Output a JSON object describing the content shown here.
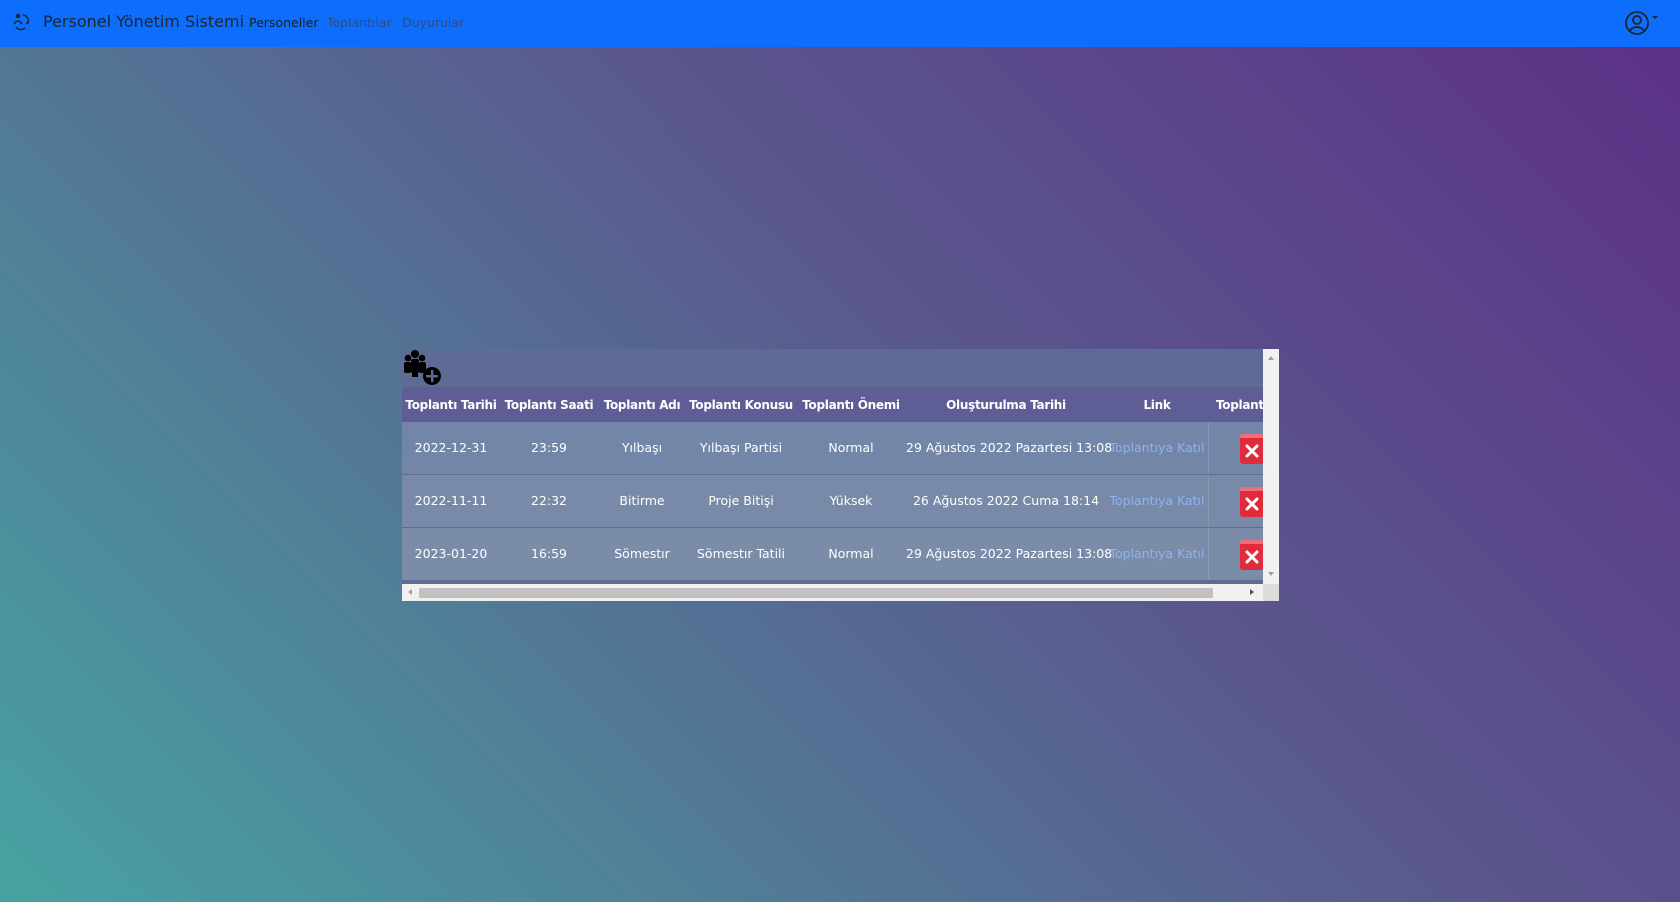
{
  "app": {
    "brand": "Personel Yönetim Sistemi",
    "brand_icon": "refresh-people-icon",
    "accent_color": "#0d6efd"
  },
  "nav": {
    "items": [
      {
        "label": "Personeller",
        "state": "active"
      },
      {
        "label": "Toplantılar",
        "state": "muted"
      },
      {
        "label": "Duyurular",
        "state": "muted"
      }
    ],
    "user_icon": "user-circle-icon"
  },
  "meetings": {
    "add_icon": "add-group-icon",
    "columns": [
      "Toplantı Tarihi",
      "Toplantı Saati",
      "Toplantı Adı",
      "Toplantı Konusu",
      "Toplantı Önemi",
      "Oluşturulma Tarihi",
      "Link",
      "Toplant"
    ],
    "rows": [
      {
        "date": "2022-12-31",
        "time": "23:59",
        "name": "Yılbaşı",
        "subject": "Yılbaşı Partisi",
        "importance": "Normal",
        "created": "29 Ağustos 2022 Pazartesi 13:08",
        "link": "Toplantıya Katıl"
      },
      {
        "date": "2022-11-11",
        "time": "22:32",
        "name": "Bitirme",
        "subject": "Proje Bitişi",
        "importance": "Yüksek",
        "created": "26 Ağustos 2022 Cuma 18:14",
        "link": "Toplantıya Katıl"
      },
      {
        "date": "2023-01-20",
        "time": "16:59",
        "name": "Sömestır",
        "subject": "Sömestır Tatili",
        "importance": "Normal",
        "created": "29 Ağustos 2022 Pazartesi 13:08",
        "link": "Toplantıya Katıl"
      }
    ],
    "delete_icon": "delete-x-icon",
    "delete_color": "#e02b3c"
  }
}
